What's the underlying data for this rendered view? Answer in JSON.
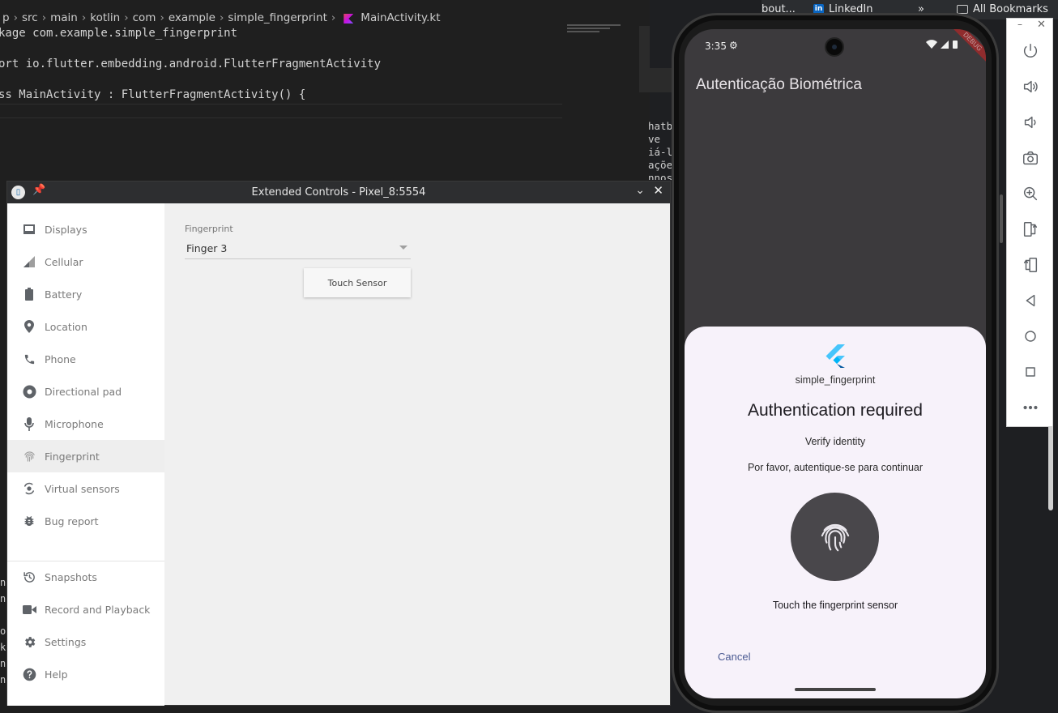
{
  "editor": {
    "breadcrumb": [
      "p",
      "src",
      "main",
      "kotlin",
      "com",
      "example",
      "simple_fingerprint"
    ],
    "file": "MainActivity.kt",
    "lines": [
      "kage com.example.simple_fingerprint",
      "ort io.flutter.embedding.android.FlutterFragmentActivity",
      "ss MainActivity : FlutterFragmentActivity() {"
    ],
    "left_stubs": [
      "n",
      "nE",
      "or",
      "ke",
      "nE",
      "nE"
    ]
  },
  "browser": {
    "tab_fragment": "bout...",
    "linkedin": "LinkedIn",
    "more": "»",
    "all_bookmarks": "All Bookmarks",
    "side_snippets": [
      "hatb",
      "ve",
      "iá-l",
      "açõe",
      "nnos"
    ]
  },
  "extended_controls": {
    "title": "Extended Controls - Pixel_8:5554",
    "nav": [
      {
        "label": "Displays",
        "icon": "display-icon"
      },
      {
        "label": "Cellular",
        "icon": "cellular-icon"
      },
      {
        "label": "Battery",
        "icon": "battery-icon"
      },
      {
        "label": "Location",
        "icon": "location-icon"
      },
      {
        "label": "Phone",
        "icon": "phone-icon"
      },
      {
        "label": "Directional pad",
        "icon": "dpad-icon"
      },
      {
        "label": "Microphone",
        "icon": "microphone-icon"
      },
      {
        "label": "Fingerprint",
        "icon": "fingerprint-icon"
      },
      {
        "label": "Virtual sensors",
        "icon": "sensors-icon"
      },
      {
        "label": "Bug report",
        "icon": "bug-icon"
      },
      {
        "label": "Snapshots",
        "icon": "snapshots-icon"
      },
      {
        "label": "Record and Playback",
        "icon": "record-icon"
      },
      {
        "label": "Settings",
        "icon": "settings-icon"
      },
      {
        "label": "Help",
        "icon": "help-icon"
      }
    ],
    "active_item": "Fingerprint",
    "fingerprint_label": "Fingerprint",
    "fingerprint_value": "Finger 3",
    "touch_button": "Touch Sensor"
  },
  "phone": {
    "time": "3:35",
    "banner": "DEBUG",
    "app_title": "Autenticação Biométrica",
    "sheet": {
      "app_name": "simple_fingerprint",
      "title": "Authentication required",
      "subtitle": "Verify identity",
      "description": "Por favor, autentique-se para continuar",
      "hint": "Touch the fingerprint sensor",
      "cancel": "Cancel"
    }
  },
  "toolbar": {
    "buttons": [
      "power-icon",
      "volume-up-icon",
      "volume-down-icon",
      "camera-icon",
      "zoom-icon",
      "rotate-left-icon",
      "rotate-right-icon",
      "back-icon",
      "home-icon",
      "overview-icon",
      "more-icon"
    ]
  },
  "colors": {
    "sheet_bg": "#f7f2fa",
    "screen_bg": "#3c3a3d",
    "cancel_text": "#4a5a92",
    "nav_active": "#eeeeee"
  }
}
